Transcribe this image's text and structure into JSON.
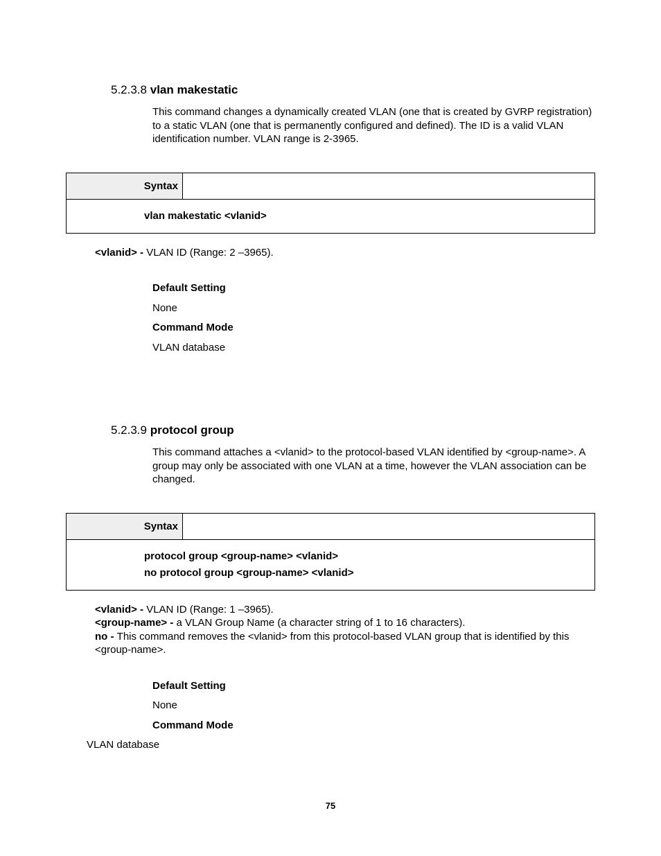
{
  "section1": {
    "number": "5.2.3.8",
    "title": "vlan makestatic",
    "description": "This command changes a dynamically created VLAN (one that is created by GVRP registration) to a static VLAN (one that is permanently configured and defined). The ID is a valid VLAN identification number. VLAN range is 2-3965.",
    "syntax_label": "Syntax",
    "syntax_line": "vlan makestatic <vlanid>",
    "param_label": "<vlanid> - ",
    "param_text": "VLAN ID (Range: 2 –3965).",
    "default_label": "Default Setting",
    "default_value": "None",
    "mode_label": "Command Mode",
    "mode_value": "VLAN database"
  },
  "section2": {
    "number": "5.2.3.9",
    "title": "protocol group",
    "description": "This command attaches a <vlanid> to the protocol-based VLAN identified by <group-name>. A group may only be associated with one VLAN at a time, however the VLAN association can be changed.",
    "syntax_label": "Syntax",
    "syntax_line1": "protocol group <group-name> <vlanid>",
    "syntax_line2": "no protocol group <group-name> <vlanid>",
    "param1_label": "<vlanid> - ",
    "param1_text": "VLAN ID (Range: 1 –3965).",
    "param2_label": "<group-name> - ",
    "param2_text": "a VLAN Group Name (a character string of 1 to 16 characters).",
    "param3_label": "no - ",
    "param3_text": "This command removes the <vlanid> from this protocol-based VLAN group that is identified by this <group-name>.",
    "default_label": "Default Setting",
    "default_value": "None",
    "mode_label": "Command Mode",
    "mode_value": "VLAN database"
  },
  "page_number": "75"
}
